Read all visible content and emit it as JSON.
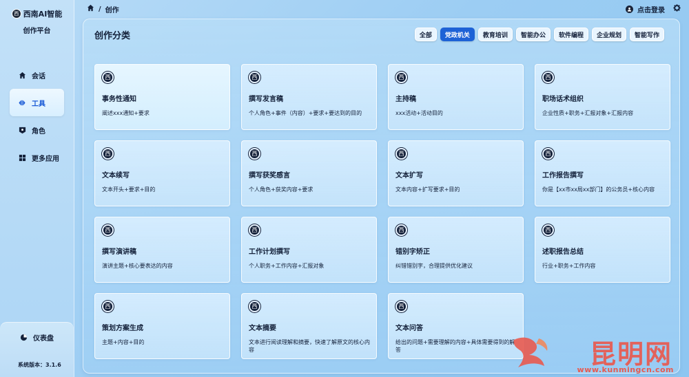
{
  "brand": {
    "name": "西南AI智能",
    "sub": "创作平台",
    "logo_text": "西"
  },
  "nav": [
    {
      "label": "会话",
      "icon": "home-icon",
      "active": false
    },
    {
      "label": "工具",
      "icon": "tools-icon",
      "active": true
    },
    {
      "label": "角色",
      "icon": "role-icon",
      "active": false
    },
    {
      "label": "更多应用",
      "icon": "apps-icon",
      "active": false
    }
  ],
  "dashboard": {
    "label": "仪表盘"
  },
  "version": "系统版本：3.1.6",
  "breadcrumb": {
    "sep": "/",
    "current": "创作"
  },
  "topbar": {
    "login": "点击登录"
  },
  "main": {
    "title": "创作分类"
  },
  "tabs": [
    {
      "label": "全部",
      "active": false
    },
    {
      "label": "党政机关",
      "active": true
    },
    {
      "label": "教育培训",
      "active": false
    },
    {
      "label": "智能办公",
      "active": false
    },
    {
      "label": "软件编程",
      "active": false
    },
    {
      "label": "企业规划",
      "active": false
    },
    {
      "label": "智能写作",
      "active": false
    }
  ],
  "cards": [
    {
      "title": "事务性通知",
      "desc": "阐述xxx通知+要求"
    },
    {
      "title": "撰写发言稿",
      "desc": "个人角色+事件（内容）+要求+要达到的目的"
    },
    {
      "title": "主持稿",
      "desc": "xxx活动+活动目的"
    },
    {
      "title": "职场话术组织",
      "desc": "企业性质+职务+汇报对象+汇报内容"
    },
    {
      "title": "文本续写",
      "desc": "文本开头+要求+目的"
    },
    {
      "title": "撰写获奖感言",
      "desc": "个人角色+获奖内容+要求"
    },
    {
      "title": "文本扩写",
      "desc": "文本内容+扩写要求+目的"
    },
    {
      "title": "工作报告撰写",
      "desc": "你是【xx市xx局xx部门】的公务员+核心内容"
    },
    {
      "title": "撰写演讲稿",
      "desc": "演讲主题+核心要表达的内容"
    },
    {
      "title": "工作计划撰写",
      "desc": "个人职务+工作内容+汇报对象"
    },
    {
      "title": "错别字矫正",
      "desc": "纠错错别字，合理提供优化建议"
    },
    {
      "title": "述职报告总结",
      "desc": "行业+职务+工作内容"
    },
    {
      "title": "策划方案生成",
      "desc": "主题+内容+目的"
    },
    {
      "title": "文本摘要",
      "desc": "文本进行阅读理解和摘要，快速了解原文的核心内容"
    },
    {
      "title": "文本问答",
      "desc": "给出的问题+需要理解的内容+具体需要得到的解答"
    }
  ],
  "watermark": {
    "name": "昆明网",
    "url": "www.kunmingcn.com"
  }
}
